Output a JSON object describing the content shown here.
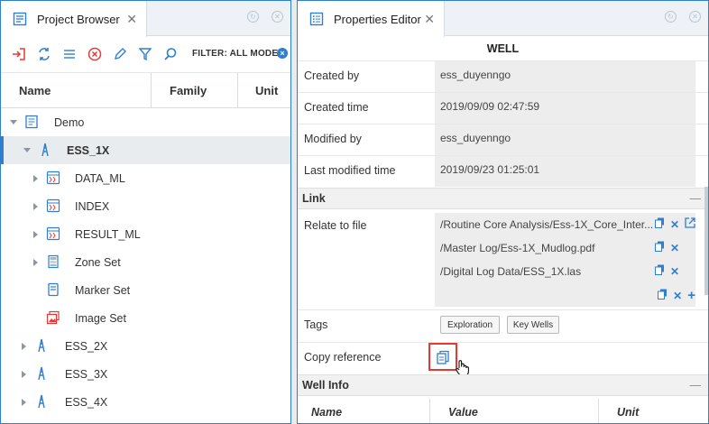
{
  "left_panel": {
    "tab_title": "Project Browser",
    "filter_label": "FILTER: ALL MODE",
    "columns": [
      "Name",
      "Family",
      "Unit"
    ],
    "tree": [
      {
        "label": "Demo",
        "icon": "project-icon",
        "expander": "down"
      },
      {
        "label": "ESS_1X",
        "icon": "well-icon",
        "expander": "down",
        "selected": true
      },
      {
        "label": "DATA_ML",
        "icon": "dataset-icon",
        "expander": "right"
      },
      {
        "label": "INDEX",
        "icon": "dataset-icon",
        "expander": "right"
      },
      {
        "label": "RESULT_ML",
        "icon": "dataset-icon",
        "expander": "right"
      },
      {
        "label": "Zone Set",
        "icon": "zoneset-icon",
        "expander": "right"
      },
      {
        "label": "Marker Set",
        "icon": "markerset-icon",
        "expander": ""
      },
      {
        "label": "Image Set",
        "icon": "imageset-icon",
        "expander": ""
      },
      {
        "label": "ESS_2X",
        "icon": "well-icon",
        "expander": "right"
      },
      {
        "label": "ESS_3X",
        "icon": "well-icon",
        "expander": "right"
      },
      {
        "label": "ESS_4X",
        "icon": "well-icon",
        "expander": "right"
      }
    ]
  },
  "right_panel": {
    "tab_title": "Properties Editor",
    "object_title": "WELL",
    "properties": [
      {
        "label": "Created by",
        "value": "ess_duyenngo"
      },
      {
        "label": "Created time",
        "value": "2019/09/09 02:47:59"
      },
      {
        "label": "Modified by",
        "value": "ess_duyenngo"
      },
      {
        "label": "Last modified time",
        "value": "2019/09/23 01:25:01"
      }
    ],
    "link_section": {
      "title": "Link",
      "collapse": "—",
      "relate_label": "Relate to file",
      "files": [
        "/Routine Core Analysis/Ess-1X_Core_Inter...",
        "/Master Log/Ess-1X_Mudlog.pdf",
        "/Digital Log Data/ESS_1X.las"
      ],
      "tags_label": "Tags",
      "tags": [
        "Exploration",
        "Key Wells"
      ],
      "copy_label": "Copy reference"
    },
    "well_info": {
      "title": "Well Info",
      "collapse": "—",
      "columns": [
        "Name",
        "Value",
        "Unit"
      ]
    }
  },
  "colors": {
    "accent": "#2f7fd0",
    "danger": "#e53935",
    "panel_bg": "#eef2f6"
  }
}
